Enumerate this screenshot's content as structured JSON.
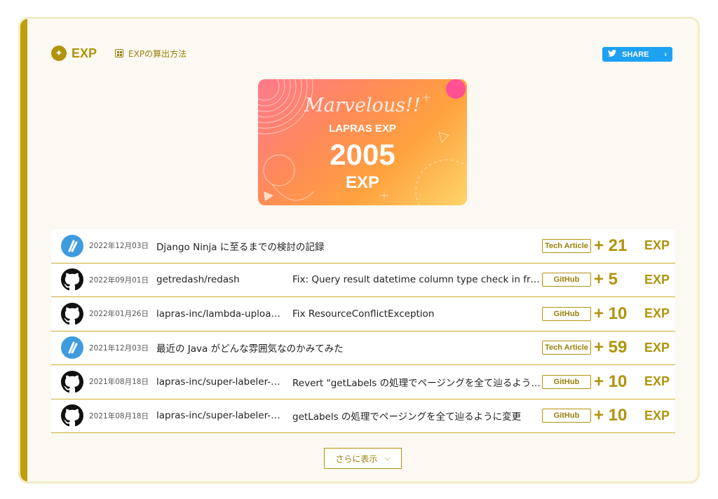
{
  "header": {
    "title": "EXP",
    "calc_link": "EXPの算出方法",
    "share_label": "SHARE"
  },
  "hero": {
    "headline": "Marvelous!!",
    "label": "LAPRAS EXP",
    "value": "2005",
    "unit": "EXP"
  },
  "items": [
    {
      "type": "tech",
      "date": "2022年12月03日",
      "title": "Django Ninja に至るまでの検討の記録",
      "commit": "",
      "tag": "Tech Article",
      "points": "+ 21",
      "unit": "EXP"
    },
    {
      "type": "github",
      "date": "2022年09月01日",
      "title": "getredash/redash",
      "commit": "Fix: Query result datetime column type check in frontend",
      "tag": "GitHub",
      "points": "+ 5",
      "unit": "EXP"
    },
    {
      "type": "github",
      "date": "2022年01月26日",
      "title": "lapras-inc/lambda-uploader",
      "commit": "Fix ResourceConflictException",
      "tag": "GitHub",
      "points": "+ 10",
      "unit": "EXP"
    },
    {
      "type": "tech",
      "date": "2021年12月03日",
      "title": "最近の Java がどんな雰囲気なのかみてみた",
      "commit": "",
      "tag": "Tech Article",
      "points": "+ 59",
      "unit": "EXP"
    },
    {
      "type": "github",
      "date": "2021年08月18日",
      "title": "lapras-inc/super-labeler-action",
      "commit": "Revert \"getLabels の処理でページングを全て辿るように変更\"",
      "tag": "GitHub",
      "points": "+ 10",
      "unit": "EXP"
    },
    {
      "type": "github",
      "date": "2021年08月18日",
      "title": "lapras-inc/super-labeler-action",
      "commit": "getLabels の処理でページングを全て辿るように変更",
      "tag": "GitHub",
      "points": "+ 10",
      "unit": "EXP"
    }
  ],
  "more_label": "さらに表示",
  "colors": {
    "accent": "#b1930c",
    "twitter": "#1da1f2",
    "tech_avatar": "#3e9bdf"
  }
}
